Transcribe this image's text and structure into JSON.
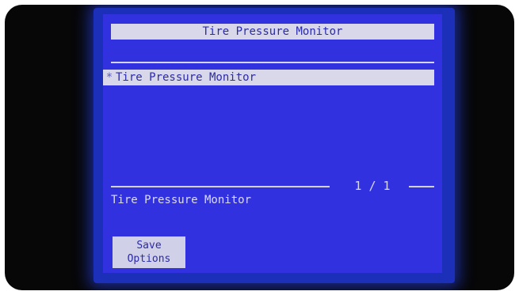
{
  "header": {
    "title": "Tire Pressure Monitor"
  },
  "menu": {
    "items": [
      {
        "marker": "*",
        "label": "Tire Pressure Monitor",
        "selected": true
      }
    ]
  },
  "pagination": {
    "text": "1 / 1"
  },
  "description": {
    "text": "Tire Pressure Monitor"
  },
  "softkeys": {
    "save_options": {
      "line1": "Save",
      "line2": "Options"
    }
  },
  "colors": {
    "screen_background": "#3131e0",
    "highlight_bar": "#d8d8ea",
    "text_on_highlight": "#2b2ba8",
    "text_on_screen": "#dcdcf4",
    "bezel": "#070708"
  }
}
